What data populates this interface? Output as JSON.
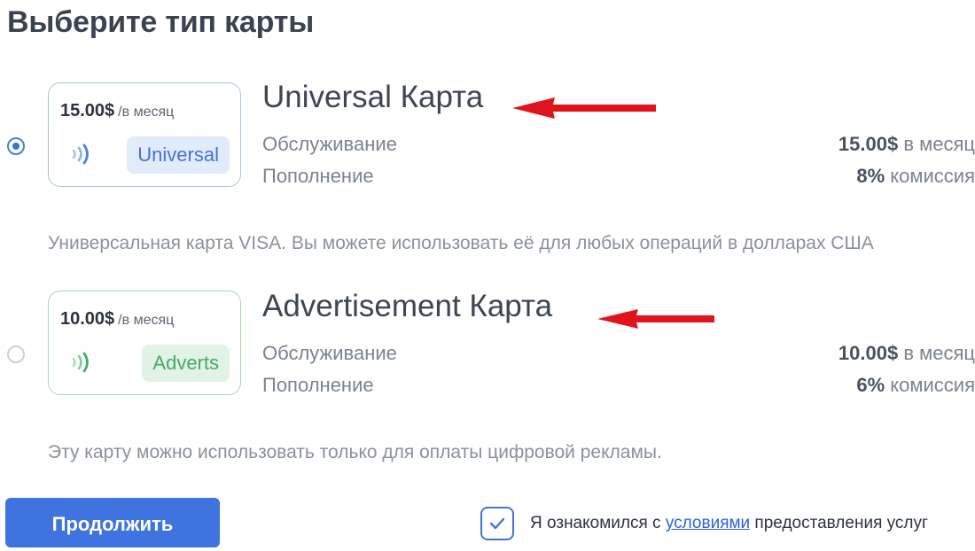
{
  "page": {
    "title": "Выберите тип карты"
  },
  "cards": [
    {
      "selected": true,
      "price": "15.00$",
      "period": "/в месяц",
      "badge": "Universal",
      "name": "Universal Карта",
      "service_label": "Обслуживание",
      "service_value": "15.00$",
      "service_unit": "в месяц",
      "topup_label": "Пополнение",
      "topup_value": "8%",
      "topup_unit": "комиссия",
      "description": "Универсальная карта VISA. Вы можете использовать её для любых операций в долларах США",
      "accent_color": "#4572d4"
    },
    {
      "selected": false,
      "price": "10.00$",
      "period": "/в месяц",
      "badge": "Adverts",
      "name": "Advertisement Карта",
      "service_label": "Обслуживание",
      "service_value": "10.00$",
      "service_unit": "в месяц",
      "topup_label": "Пополнение",
      "topup_value": "6%",
      "topup_unit": "комиссия",
      "description": "Эту карту можно использовать только для оплаты цифровой рекламы.",
      "accent_color": "#46a964"
    }
  ],
  "actions": {
    "continue_label": "Продолжить"
  },
  "agreement": {
    "checked": true,
    "prefix": "Я ознакомился с ",
    "link": "условиями",
    "suffix": " предоставления услуг"
  },
  "colors": {
    "primary": "#3f74e0",
    "annotation_arrow": "#e0141c"
  },
  "icons": {
    "contactless": "contactless-icon",
    "check": "check-icon"
  }
}
